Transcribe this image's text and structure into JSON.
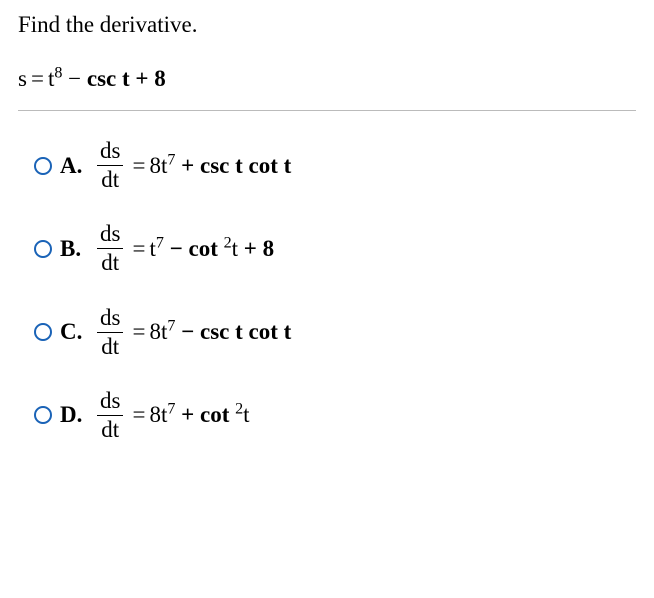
{
  "prompt": "Find the derivative.",
  "equation": {
    "lhs": "s",
    "eq": "=",
    "t": "t",
    "exp8": "8",
    "minus": " − ",
    "csc": "csc t",
    "plus8": " + 8"
  },
  "frac": {
    "num": "ds",
    "den": "dt"
  },
  "options": [
    {
      "letter": "A.",
      "eq": "=",
      "coef": "8t",
      "exp": "7",
      "rest": " +  csc t cot t"
    },
    {
      "letter": "B.",
      "eq": "=",
      "coef": "t",
      "exp": "7",
      "mid": " −  cot ",
      "exp2": "2",
      "afterexp": "t",
      "tail": " + 8"
    },
    {
      "letter": "C.",
      "eq": "=",
      "coef": "8t",
      "exp": "7",
      "rest": " −  csc t cot t"
    },
    {
      "letter": "D.",
      "eq": "=",
      "coef": "8t",
      "exp": "7",
      "mid": " +  cot ",
      "exp2": "2",
      "afterexp": "t",
      "tail": ""
    }
  ]
}
